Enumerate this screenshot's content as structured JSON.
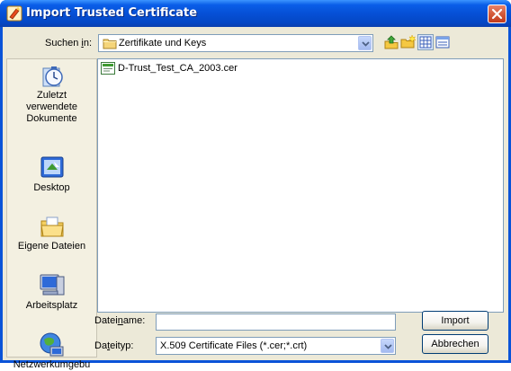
{
  "window": {
    "title": "Import Trusted Certificate"
  },
  "lookin": {
    "label_pre": "Suchen ",
    "label_key": "i",
    "label_post": "n:",
    "value": "Zertifikate und Keys"
  },
  "places": [
    {
      "lines": [
        "Zuletzt",
        "verwendete",
        "Dokumente"
      ],
      "icon": "recent-documents-icon"
    },
    {
      "lines": [
        "Desktop"
      ],
      "icon": "desktop-icon"
    },
    {
      "lines": [
        "Eigene Dateien"
      ],
      "icon": "my-documents-icon"
    },
    {
      "lines": [
        "Arbeitsplatz"
      ],
      "icon": "my-computer-icon"
    },
    {
      "lines": [
        "Netzwerkumgebu"
      ],
      "icon": "network-places-icon"
    }
  ],
  "files": [
    {
      "name": "D-Trust_Test_CA_2003.cer",
      "icon": "certificate-file-icon"
    }
  ],
  "filename": {
    "label_pre": "Datei",
    "label_key": "n",
    "label_post": "ame:",
    "value": "",
    "placeholder": ""
  },
  "filetype": {
    "label_pre": "Da",
    "label_key": "t",
    "label_post": "eityp:",
    "value": "X.509 Certificate Files (*.cer;*.crt)"
  },
  "buttons": {
    "import": "Import",
    "cancel": "Abbrechen"
  }
}
